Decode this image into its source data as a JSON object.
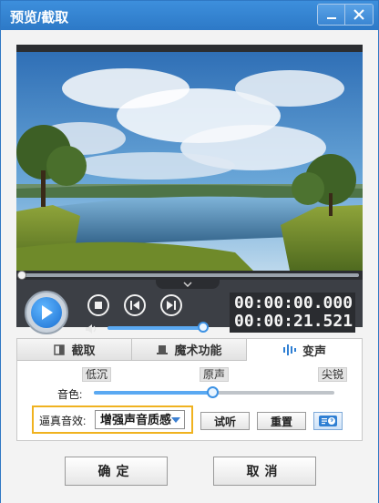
{
  "window": {
    "title": "预览/截取",
    "accent_color": "#2d79c7"
  },
  "player": {
    "current_time": "00:00:00.000",
    "total_time": "00:00:21.521",
    "seek_progress": 0.0,
    "volume_level": 0.95,
    "icons": [
      "play-icon",
      "stop-icon",
      "prev-frame-icon",
      "next-frame-icon",
      "speaker-icon",
      "chevron-down-icon"
    ]
  },
  "tabs": [
    {
      "label": "截取",
      "icon": "crop-icon",
      "active": false
    },
    {
      "label": "魔术功能",
      "icon": "magic-hat-icon",
      "active": false
    },
    {
      "label": "变声",
      "icon": "waveform-icon",
      "active": true
    }
  ],
  "voice": {
    "scale_low": "低沉",
    "scale_mid": "原声",
    "scale_high": "尖锐",
    "timbre_label": "音色:",
    "timbre_level": 0.5,
    "effect_label": "逼真音效:",
    "effect_value": "增强声音质感",
    "try_label": "试听",
    "reset_label": "重置",
    "help_icon": "help-icon"
  },
  "footer": {
    "ok_label": "确定",
    "cancel_label": "取消"
  }
}
